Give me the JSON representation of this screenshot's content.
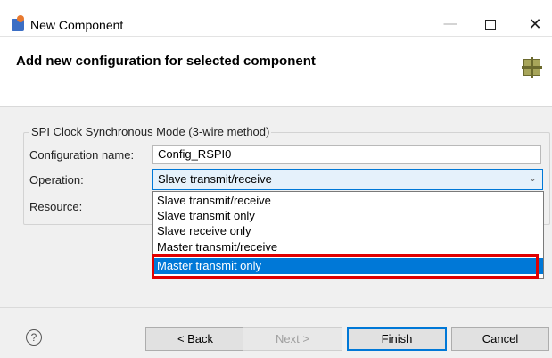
{
  "window": {
    "title": "New Component",
    "minimize_glyph": "—",
    "close_glyph": "✕"
  },
  "header": {
    "title": "Add new configuration for selected component"
  },
  "group": {
    "title": "SPI Clock Synchronous Mode (3-wire method)",
    "config_name_label": "Configuration name:",
    "config_name_value": "Config_RSPI0",
    "operation_label": "Operation:",
    "operation_value": "Slave transmit/receive",
    "resource_label": "Resource:"
  },
  "dropdown": {
    "options": [
      "Slave transmit/receive",
      "Slave transmit only",
      "Slave receive only",
      "Master transmit/receive",
      "Master transmit only"
    ],
    "selected_index": 4
  },
  "footer": {
    "help_glyph": "?",
    "back_label": "< Back",
    "next_label": "Next >",
    "finish_label": "Finish",
    "cancel_label": "Cancel"
  },
  "colors": {
    "selection": "#0078d7",
    "highlight_box": "#e00000"
  }
}
